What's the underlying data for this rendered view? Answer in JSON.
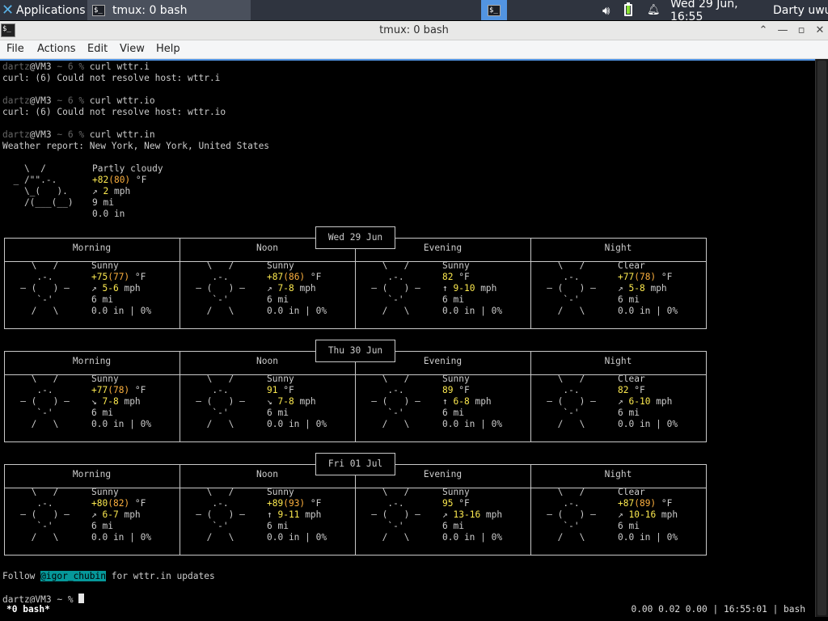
{
  "panel": {
    "apps_label": "Applications",
    "task_label": "tmux: 0 bash",
    "term_glyph": "$_",
    "clock": "Wed 29 Jun, 16:55",
    "user": "Darty uwu"
  },
  "window": {
    "title": "tmux: 0 bash"
  },
  "menu": [
    "File",
    "Actions",
    "Edit",
    "View",
    "Help"
  ],
  "terminal": {
    "lines": [
      {
        "prompt_user": "dartz",
        "prompt_host": "@VM3",
        "prompt_rest": " ~ 6 % ",
        "cmd": "curl wttr.i"
      },
      {
        "text": "curl: (6) Could not resolve host: wttr.i"
      },
      {
        "prompt_user": "dartz",
        "prompt_host": "@VM3",
        "prompt_rest": " ~ 6 % ",
        "cmd": "curl wttr.io"
      },
      {
        "text": "curl: (6) Could not resolve host: wttr.io"
      },
      {
        "prompt_user": "dartz",
        "prompt_host": "@VM3",
        "prompt_rest": " ~ 6 % ",
        "cmd": "curl wttr.in"
      },
      {
        "text": "Weather report: New York, New York, United States"
      }
    ],
    "current": {
      "art": [
        "    \\  /",
        "  _ /\"\".-.",
        "    \\_(   ).",
        "    /(___(__)",
        ""
      ],
      "condition": "Partly cloudy",
      "temp": "+82",
      "feels": "(80)",
      "unit": " °F",
      "wind_arrow": "↗",
      "wind": "2",
      "wind_unit": " mph",
      "visibility": "9 mi",
      "precip": "0.0 in"
    },
    "footer_pre": "Follow ",
    "footer_handle": "@igor_chubin",
    "footer_post": " for wttr.in updates",
    "final_prompt": "dartz@VM3 ~ % "
  },
  "forecast": {
    "periods": [
      "Morning",
      "Noon",
      "Evening",
      "Night"
    ],
    "sun_art": [
      "     \\   /",
      "      .-.",
      "   ― (   ) ―",
      "      `-'",
      "     /   \\"
    ],
    "moon_art": [
      "     \\   /",
      "      .-.",
      "   ― (   ) ―",
      "      `-'",
      "     /   \\"
    ],
    "days": [
      {
        "date": "Wed 29 Jun",
        "cells": [
          {
            "cond": "Sunny",
            "temp": "+75",
            "feels": "(77)",
            "arrow": "↗",
            "wind": "5-6",
            "vis": "6 mi",
            "precip": "0.0 in | 0%"
          },
          {
            "cond": "Sunny",
            "temp": "+87",
            "feels": "(86)",
            "arrow": "↗",
            "wind": "7-8",
            "vis": "6 mi",
            "precip": "0.0 in | 0%"
          },
          {
            "cond": "Sunny",
            "temp": "82",
            "feels": "",
            "arrow": "↑",
            "wind": "9-10",
            "vis": "6 mi",
            "precip": "0.0 in | 0%"
          },
          {
            "cond": "Clear",
            "temp": "+77",
            "feels": "(78)",
            "arrow": "↗",
            "wind": "5-8",
            "vis": "6 mi",
            "precip": "0.0 in | 0%"
          }
        ]
      },
      {
        "date": "Thu 30 Jun",
        "cells": [
          {
            "cond": "Sunny",
            "temp": "+77",
            "feels": "(78)",
            "arrow": "↘",
            "wind": "7-8",
            "vis": "6 mi",
            "precip": "0.0 in | 0%"
          },
          {
            "cond": "Sunny",
            "temp": "91",
            "feels": "",
            "arrow": "↘",
            "wind": "7-8",
            "vis": "6 mi",
            "precip": "0.0 in | 0%"
          },
          {
            "cond": "Sunny",
            "temp": "89",
            "feels": "",
            "arrow": "↑",
            "wind": "6-8",
            "vis": "6 mi",
            "precip": "0.0 in | 0%"
          },
          {
            "cond": "Clear",
            "temp": "82",
            "feels": "",
            "arrow": "↗",
            "wind": "6-10",
            "vis": "6 mi",
            "precip": "0.0 in | 0%"
          }
        ]
      },
      {
        "date": "Fri 01 Jul",
        "cells": [
          {
            "cond": "Sunny",
            "temp": "+80",
            "feels": "(82)",
            "arrow": "↗",
            "wind": "6-7",
            "vis": "6 mi",
            "precip": "0.0 in | 0%"
          },
          {
            "cond": "Sunny",
            "temp": "+89",
            "feels": "(93)",
            "arrow": "↑",
            "wind": "9-11",
            "vis": "6 mi",
            "precip": "0.0 in | 0%"
          },
          {
            "cond": "Sunny",
            "temp": "95",
            "feels": "",
            "arrow": "↗",
            "wind": "13-16",
            "vis": "6 mi",
            "precip": "0.0 in | 0%"
          },
          {
            "cond": "Clear",
            "temp": "+87",
            "feels": "(89)",
            "arrow": "↗",
            "wind": "10-16",
            "vis": "6 mi",
            "precip": "0.0 in | 0%"
          }
        ]
      }
    ]
  },
  "tmux": {
    "left": "*0 bash*",
    "right": "0.00 0.02 0.00 | 16:55:01 | bash"
  }
}
